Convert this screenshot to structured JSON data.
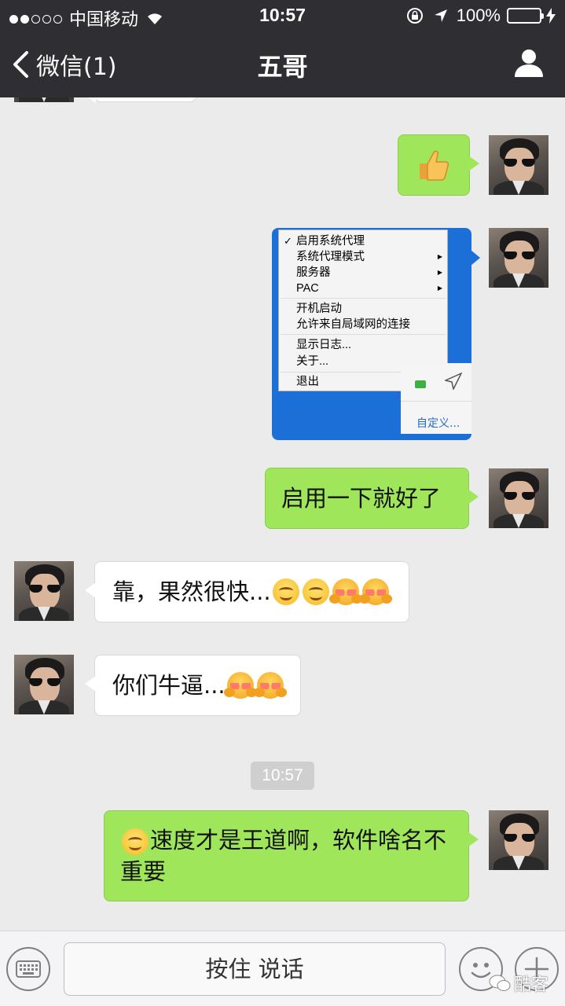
{
  "status_bar": {
    "carrier": "中国移动",
    "time": "10:57",
    "battery": "100%",
    "signal_bars_filled": 2,
    "signal_bars_total": 5
  },
  "nav": {
    "back_label": "微信(1)",
    "title": "五哥"
  },
  "messages": {
    "thumbs_up": "thumbs-up",
    "image_menu": {
      "items": [
        "启用系统代理",
        "系统代理模式",
        "服务器",
        "PAC",
        "开机启动",
        "允许来自局域网的连接",
        "显示日志...",
        "关于...",
        "退出"
      ],
      "checked_item": "启用系统代理",
      "tray_link": "自定义..."
    },
    "msg_enable": "启用一下就好了",
    "msg_fast": "靠，果然很快...",
    "msg_awesome": "你们牛逼...",
    "timestamp": "10:57",
    "msg_speed": "速度才是王道啊，软件啥名不重要"
  },
  "input_bar": {
    "hold_to_talk": "按住 说话"
  },
  "watermark": "酷客",
  "colors": {
    "header": "#2e2e33",
    "sent_bubble": "#9fe65a",
    "received_bubble": "#ffffff",
    "background": "#ebebeb"
  }
}
